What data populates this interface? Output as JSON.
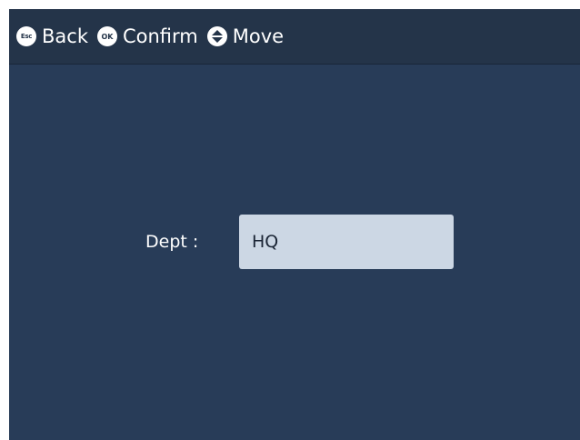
{
  "toolbar": {
    "back": {
      "key": "Esc",
      "label": "Back",
      "icon": "esc-key-icon"
    },
    "confirm": {
      "key": "OK",
      "label": "Confirm",
      "icon": "ok-key-icon"
    },
    "move": {
      "label": "Move",
      "icon": "up-down-arrows-icon"
    }
  },
  "form": {
    "dept": {
      "label": "Dept :",
      "value": "HQ"
    }
  },
  "colors": {
    "screen_background": "#283c58",
    "toolbar_background": "#243449",
    "input_background": "#ccd7e4",
    "text": "#ffffff"
  }
}
